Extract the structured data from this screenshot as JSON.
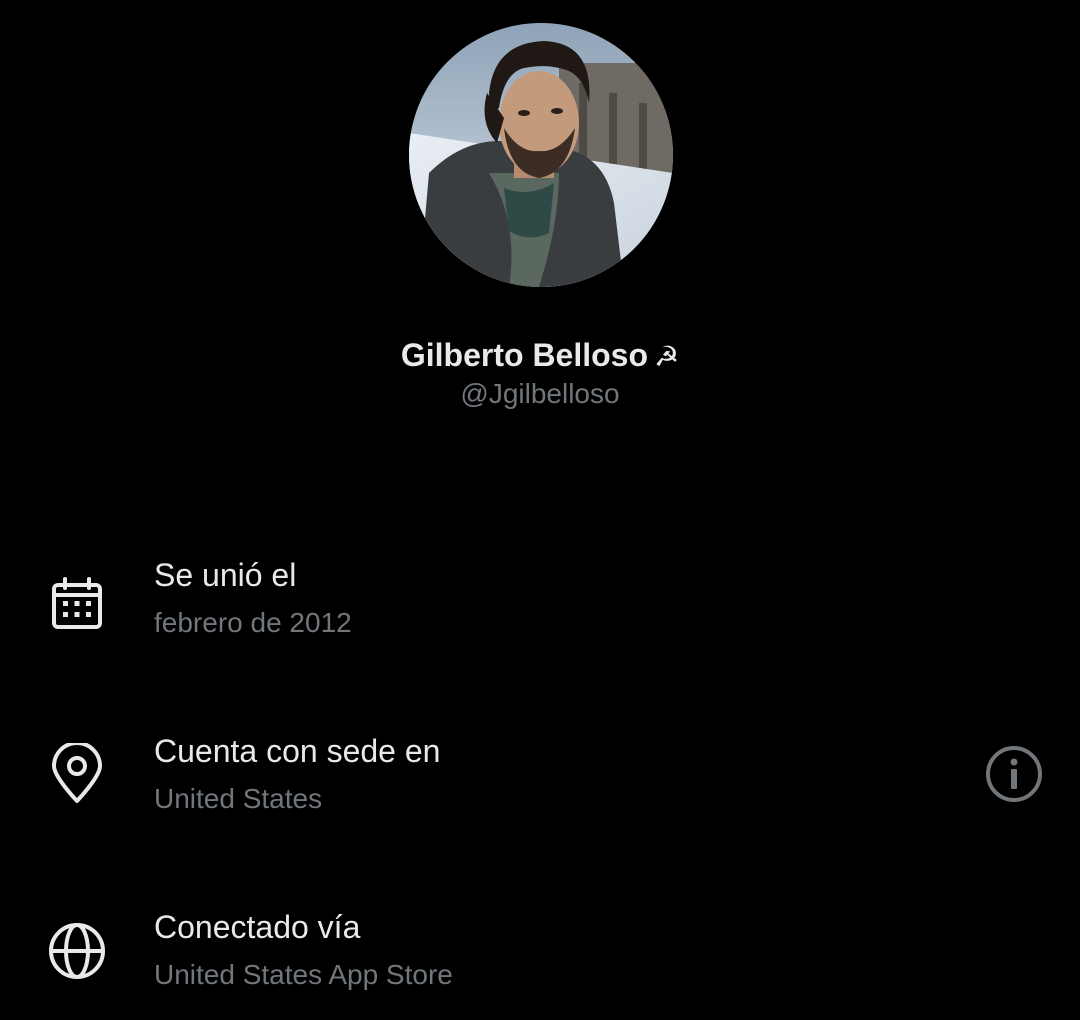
{
  "profile": {
    "display_name": "Gilberto Belloso",
    "name_emoji": "☭",
    "handle": "@Jgilbelloso",
    "avatar_icon": "avatar-photo"
  },
  "about": {
    "joined": {
      "icon": "calendar-icon",
      "title": "Se unió el",
      "value": "febrero de 2012"
    },
    "location": {
      "icon": "location-pin-icon",
      "title": "Cuenta con sede en",
      "value": "United States",
      "info_icon": "info-icon"
    },
    "connected": {
      "icon": "globe-icon",
      "title": "Conectado vía",
      "value": "United States App Store"
    }
  },
  "colors": {
    "background": "#000000",
    "primary_text": "#e7e9ea",
    "secondary_text": "#71767b",
    "icon": "#e7e9ea"
  }
}
